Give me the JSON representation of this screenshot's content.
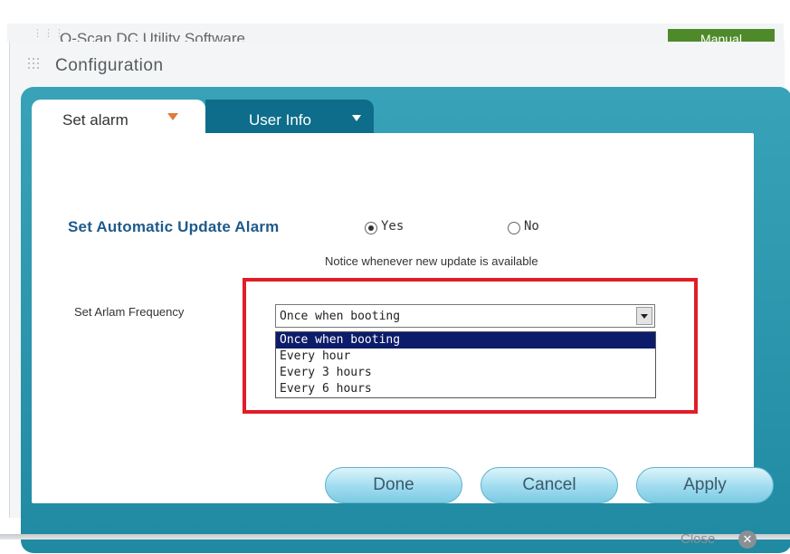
{
  "background_window": {
    "title": "Q-Scan DC Utility Software",
    "manual_button": "Manual"
  },
  "window": {
    "title": "Configuration"
  },
  "tabs": [
    {
      "label": "Set alarm",
      "active": true
    },
    {
      "label": "User Info",
      "active": false
    }
  ],
  "alarm": {
    "label": "Set Automatic Update Alarm",
    "options": [
      {
        "label": "Yes",
        "checked": true
      },
      {
        "label": "No",
        "checked": false
      }
    ],
    "notice": "Notice whenever new update is available"
  },
  "frequency": {
    "label": "Set Arlam Frequency",
    "selected": "Once when booting",
    "options": [
      "Once when booting",
      "Every hour",
      "Every 3 hours",
      "Every 6 hours"
    ],
    "highlighted_index": 0
  },
  "buttons": {
    "done": "Done",
    "cancel": "Cancel",
    "apply": "Apply"
  },
  "close": {
    "label": "Close"
  },
  "colors": {
    "panel_teal": "#2a97ae",
    "tab_inactive": "#0e6d8a",
    "highlight_red": "#e01e28",
    "selected_option": "#0c1c6a"
  },
  "icons": [
    "dropdown-triangle-icon",
    "close-circle-icon",
    "grip-icon"
  ]
}
